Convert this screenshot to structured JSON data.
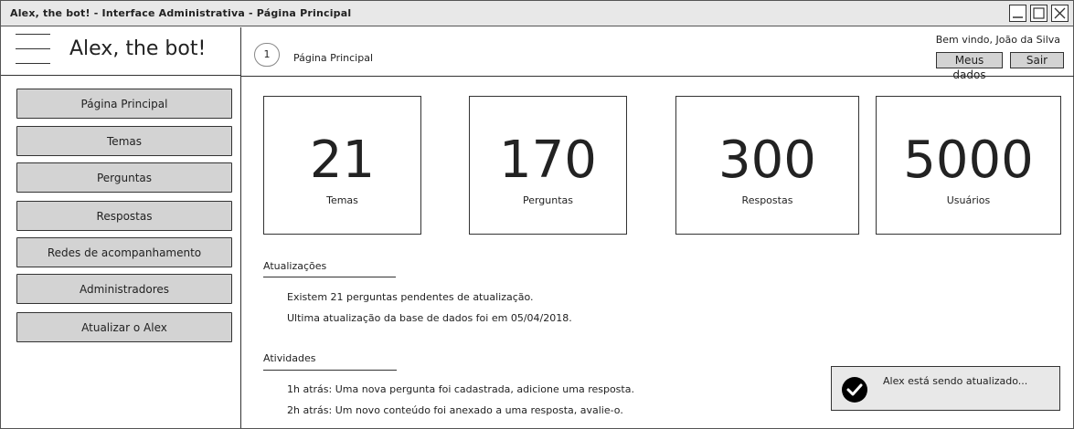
{
  "window": {
    "title": "Alex, the bot! - Interface Administrativa - Página Principal"
  },
  "sidebar": {
    "brand": "Alex, the bot!",
    "items": [
      {
        "label": "Página Principal"
      },
      {
        "label": "Temas"
      },
      {
        "label": "Perguntas"
      },
      {
        "label": "Respostas"
      },
      {
        "label": "Redes de acompanhamento"
      },
      {
        "label": "Administradores"
      },
      {
        "label": "Atualizar o Alex"
      }
    ]
  },
  "header": {
    "crumb_number": "1",
    "crumb_label": "Página Principal",
    "welcome": "Bem vindo, João da Silva",
    "my_data_label": "Meus dados",
    "logout_label": "Sair"
  },
  "stats": [
    {
      "value": "21",
      "label": "Temas"
    },
    {
      "value": "170",
      "label": "Perguntas"
    },
    {
      "value": "300",
      "label": "Respostas"
    },
    {
      "value": "5000",
      "label": "Usuários"
    }
  ],
  "updates": {
    "title": "Atualizações",
    "lines": [
      "Existem 21 perguntas pendentes de atualização.",
      "Ultima atualização da base de dados foi em 05/04/2018."
    ]
  },
  "activities": {
    "title": "Atividades",
    "lines": [
      "1h atrás: Uma nova pergunta foi cadastrada, adicione uma resposta.",
      "2h atrás: Um novo conteúdo foi anexado a uma resposta, avalie-o."
    ]
  },
  "toast": {
    "message": "Alex está sendo atualizado..."
  },
  "icons": [
    "hamburger-icon",
    "minimize-icon",
    "maximize-icon",
    "close-icon",
    "check-circle-icon"
  ]
}
